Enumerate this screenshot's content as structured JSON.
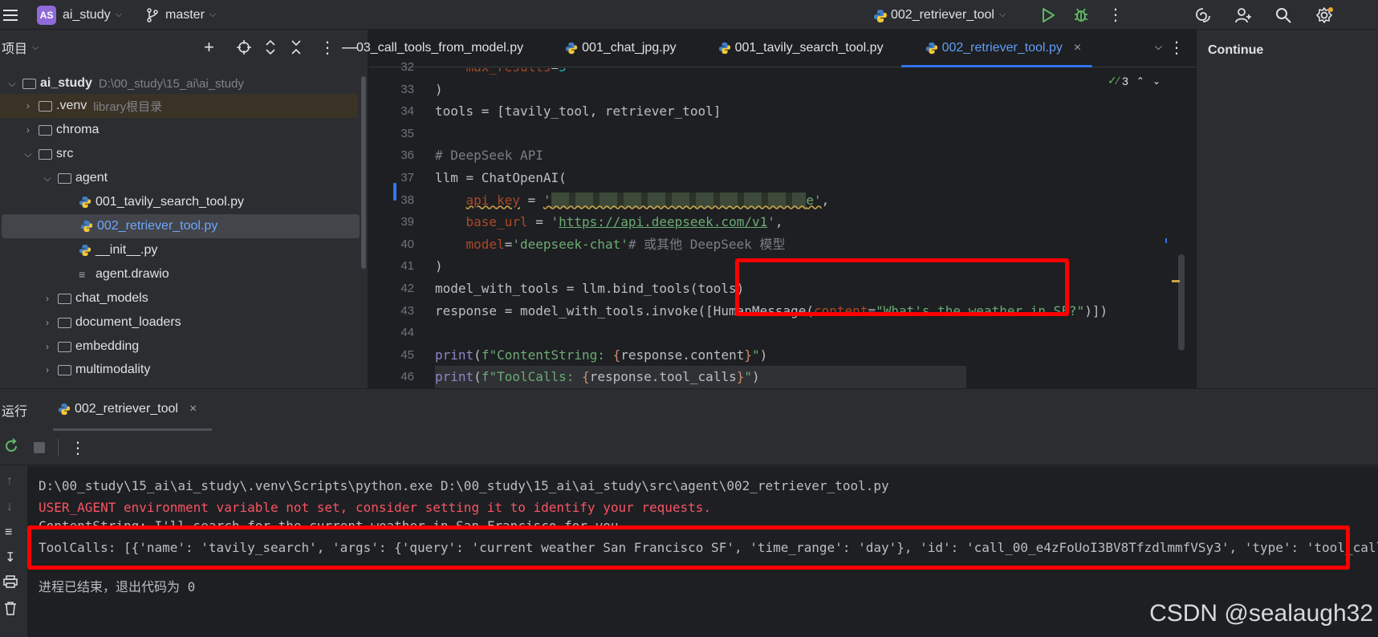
{
  "toolbar": {
    "project_badge": "AS",
    "project_name": "ai_study",
    "branch": "master",
    "run_config": "002_retriever_tool"
  },
  "project_panel": {
    "title": "项目",
    "tree": [
      {
        "label": "ai_study",
        "hint": "D:\\00_study\\15_ai\\ai_study",
        "type": "folder",
        "open": true
      },
      {
        "label": ".venv",
        "hint": "library根目录",
        "type": "folder",
        "open": false
      },
      {
        "label": "chroma",
        "hint": "",
        "type": "folder",
        "open": false
      },
      {
        "label": "src",
        "hint": "",
        "type": "folder",
        "open": true
      },
      {
        "label": "agent",
        "hint": "",
        "type": "folder",
        "open": true
      },
      {
        "label": "001_tavily_search_tool.py",
        "hint": "",
        "type": "py"
      },
      {
        "label": "002_retriever_tool.py",
        "hint": "",
        "type": "py",
        "selected": true
      },
      {
        "label": "__init__.py",
        "hint": "",
        "type": "py"
      },
      {
        "label": "agent.drawio",
        "hint": "",
        "type": "file"
      },
      {
        "label": "chat_models",
        "hint": "",
        "type": "folder",
        "open": false
      },
      {
        "label": "document_loaders",
        "hint": "",
        "type": "folder",
        "open": false
      },
      {
        "label": "embedding",
        "hint": "",
        "type": "folder",
        "open": false
      },
      {
        "label": "multimodality",
        "hint": "",
        "type": "folder",
        "open": false
      }
    ]
  },
  "editor": {
    "tabs": [
      {
        "label": "03_call_tools_from_model.py"
      },
      {
        "label": "001_chat_jpg.py"
      },
      {
        "label": "001_tavily_search_tool.py"
      },
      {
        "label": "002_retriever_tool.py",
        "active": true
      }
    ],
    "inspection_count": "3",
    "line_numbers": [
      "32",
      "33",
      "34",
      "35",
      "36",
      "37",
      "38",
      "39",
      "40",
      "41",
      "42",
      "43",
      "44",
      "45",
      "46"
    ]
  },
  "right_panel": {
    "title": "Continue"
  },
  "run_panel": {
    "label": "运行",
    "tab": "002_retriever_tool",
    "console": {
      "cmd": "D:\\00_study\\15_ai\\ai_study\\.venv\\Scripts\\python.exe D:\\00_study\\15_ai\\ai_study\\src\\agent\\002_retriever_tool.py",
      "warning": "USER_AGENT environment variable not set, consider setting it to identify your requests.",
      "content": "ContentString: I'll search for the current weather in San Francisco for you.",
      "toolcalls": "ToolCalls: [{'name': 'tavily_search', 'args': {'query': 'current weather San Francisco SF', 'time_range': 'day'}, 'id': 'call_00_e4zFoUoI3BV8TfzdlmmfVSy3', 'type': 'tool_call'}]",
      "exit": "进程已结束，退出代码为 0"
    }
  },
  "watermark": "CSDN @sealaugh32",
  "colors": {
    "accent": "#3574f0",
    "highlight_box": "#ff0000",
    "error_text": "#f75464"
  }
}
